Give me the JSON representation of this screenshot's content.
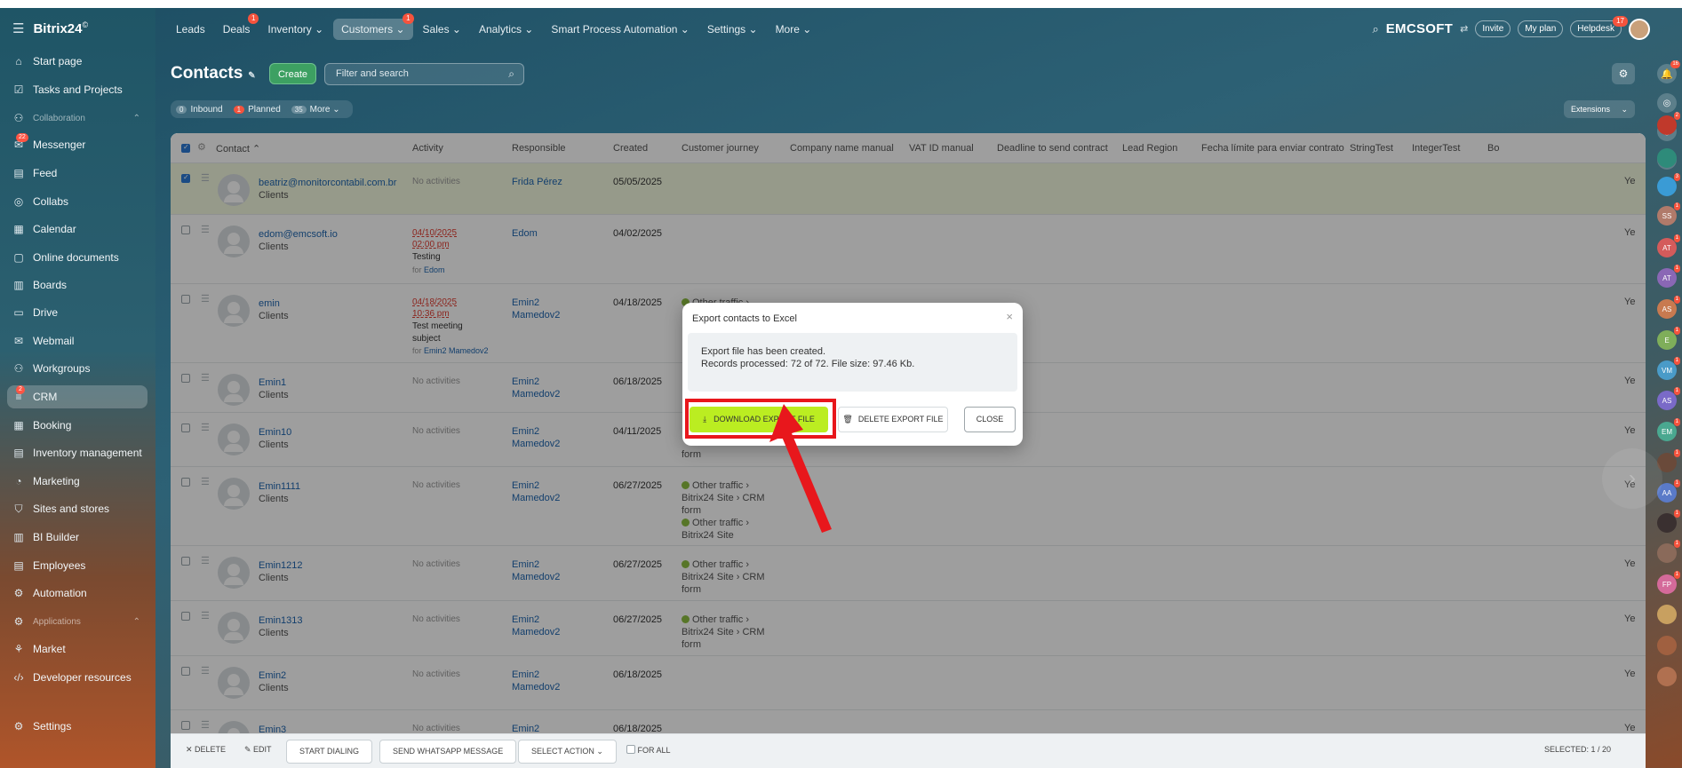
{
  "app": {
    "logo": "Bitrix24",
    "logo_sup": "©",
    "company": "EMCSOFT"
  },
  "topnav": [
    {
      "label": "Leads",
      "badge": ""
    },
    {
      "label": "Deals",
      "badge": "1"
    },
    {
      "label": "Inventory ⌄",
      "badge": ""
    },
    {
      "label": "Customers ⌄",
      "badge": "1",
      "active": true
    },
    {
      "label": "Sales ⌄",
      "badge": ""
    },
    {
      "label": "Analytics ⌄",
      "badge": ""
    },
    {
      "label": "Smart Process Automation ⌄",
      "badge": ""
    },
    {
      "label": "Settings ⌄",
      "badge": ""
    },
    {
      "label": "More ⌄",
      "badge": ""
    }
  ],
  "topright": {
    "invite": "Invite",
    "myplan": "My plan",
    "helpdesk": "Helpdesk",
    "helpdesk_badge": "17"
  },
  "sidebar": [
    {
      "label": "Start page",
      "icon": "⌂"
    },
    {
      "label": "Tasks and Projects",
      "icon": "☑"
    },
    {
      "label": "Collaboration",
      "icon": "⚇",
      "group": true
    },
    {
      "label": "Messenger",
      "icon": "✉",
      "badge": "22"
    },
    {
      "label": "Feed",
      "icon": "▤"
    },
    {
      "label": "Collabs",
      "icon": "◎"
    },
    {
      "label": "Calendar",
      "icon": "▦"
    },
    {
      "label": "Online documents",
      "icon": "▢"
    },
    {
      "label": "Boards",
      "icon": "▥"
    },
    {
      "label": "Drive",
      "icon": "▭"
    },
    {
      "label": "Webmail",
      "icon": "✉"
    },
    {
      "label": "Workgroups",
      "icon": "⚇"
    },
    {
      "label": "CRM",
      "icon": "≡",
      "active": true,
      "badge": "2"
    },
    {
      "label": "Booking",
      "icon": "▦"
    },
    {
      "label": "Inventory management",
      "icon": "▤"
    },
    {
      "label": "Marketing",
      "icon": "◔"
    },
    {
      "label": "Sites and stores",
      "icon": "⛉"
    },
    {
      "label": "BI Builder",
      "icon": "▥"
    },
    {
      "label": "Employees",
      "icon": "▤"
    },
    {
      "label": "Automation",
      "icon": "⚙"
    },
    {
      "label": "Applications",
      "icon": "⚙",
      "group": true
    },
    {
      "label": "Market",
      "icon": "⚘"
    },
    {
      "label": "Developer resources",
      "icon": "‹/›"
    },
    {
      "label": "Settings",
      "icon": "⚙"
    }
  ],
  "page": {
    "title": "Contacts",
    "create": "Create",
    "search_placeholder": "Filter and search",
    "filters": [
      {
        "count": "0",
        "label": "Inbound",
        "red": false
      },
      {
        "count": "1",
        "label": "Planned",
        "red": true
      },
      {
        "count": "35",
        "label": "More ⌄",
        "red": false
      }
    ],
    "extensions": "Extensions"
  },
  "columns": [
    "Contact ⌃",
    "Activity",
    "Responsible",
    "Created",
    "Customer journey",
    "Company name manual",
    "VAT ID manual",
    "Deadline to send contract",
    "Lead Region",
    "Fecha límite para enviar contrato",
    "StringTest",
    "IntegerTest",
    "Bo"
  ],
  "rows": [
    {
      "name": "beatriz@monitorcontabil.com.br",
      "type": "Clients",
      "activity": "No activities",
      "resp": "Frida Pérez",
      "created": "05/05/2025",
      "ye": "Ye",
      "selected": true
    },
    {
      "name": "edom@emcsoft.io",
      "type": "Clients",
      "act_date": "04/10/2025",
      "act_time": "02:00 pm",
      "act_subject": "Testing",
      "act_for": "Edom",
      "resp": "Edom",
      "created": "04/02/2025",
      "ye": "Ye"
    },
    {
      "name": "emin",
      "type": "Clients",
      "act_date": "04/18/2025",
      "act_time": "10:36 pm",
      "act_subject": "Test meeting subject",
      "act_for": "Emin2 Mamedov2",
      "resp": "Emin2 Mamedov2",
      "created": "04/18/2025",
      "journey": "Other traffic ›",
      "ye": "Ye"
    },
    {
      "name": "Emin1",
      "type": "Clients",
      "activity": "No activities",
      "resp": "Emin2 Mamedov2",
      "created": "06/18/2025",
      "ye": "Ye"
    },
    {
      "name": "Emin10",
      "type": "Clients",
      "activity": "No activities",
      "resp": "Emin2 Mamedov2",
      "created": "04/11/2025",
      "journey_tail": "form",
      "ye": "Ye"
    },
    {
      "name": "Emin1111",
      "type": "Clients",
      "activity": "No activities",
      "resp": "Emin2 Mamedov2",
      "created": "06/27/2025",
      "journey": "Other traffic ›",
      "journey2": "Bitrix24 Site › CRM",
      "journey3": "form",
      "journey4": "Other traffic ›",
      "journey5": "Bitrix24 Site",
      "ye": "Ye"
    },
    {
      "name": "Emin1212",
      "type": "Clients",
      "activity": "No activities",
      "resp": "Emin2 Mamedov2",
      "created": "06/27/2025",
      "journey": "Other traffic ›",
      "journey2": "Bitrix24 Site › CRM",
      "journey3": "form",
      "ye": "Ye"
    },
    {
      "name": "Emin1313",
      "type": "Clients",
      "activity": "No activities",
      "resp": "Emin2 Mamedov2",
      "created": "06/27/2025",
      "journey": "Other traffic ›",
      "journey2": "Bitrix24 Site › CRM",
      "journey3": "form",
      "ye": "Ye"
    },
    {
      "name": "Emin2",
      "type": "Clients",
      "activity": "No activities",
      "resp": "Emin2 Mamedov2",
      "created": "06/18/2025",
      "ye": "Ye"
    },
    {
      "name": "Emin3",
      "type": "Clients",
      "activity": "No activities",
      "resp": "Emin2",
      "created": "06/18/2025",
      "ye": "Ye"
    }
  ],
  "bottombar": {
    "delete": "DELETE",
    "edit": "EDIT",
    "dialing": "START DIALING",
    "whatsapp": "SEND WHATSAPP MESSAGE",
    "select_action": "SELECT ACTION",
    "for_all": "FOR ALL",
    "selected": "SELECTED: 1 / 20"
  },
  "modal": {
    "title": "Export contacts to Excel",
    "line1": "Export file has been created.",
    "line2": "Records processed: 72 of 72. File size: 97.46 Kb.",
    "download": "DOWNLOAD EXPORT FILE",
    "delete": "DELETE EXPORT FILE",
    "close": "CLOSE"
  },
  "rail": [
    {
      "label": "",
      "color": "#c0392b",
      "badge": "2"
    },
    {
      "label": "",
      "color": "#2e8b7a",
      "badge": ""
    },
    {
      "label": "",
      "color": "#3a9bd5",
      "badge": "3"
    },
    {
      "label": "SS",
      "color": "#b07a6a",
      "badge": "1"
    },
    {
      "label": "AT",
      "color": "#d45b5b",
      "badge": "1"
    },
    {
      "label": "AT",
      "color": "#8a67b5",
      "badge": "1"
    },
    {
      "label": "AS",
      "color": "#c87a50",
      "badge": "1"
    },
    {
      "label": "E",
      "color": "#7fae5a",
      "badge": "1"
    },
    {
      "label": "VM",
      "color": "#4a9bc8",
      "badge": "1"
    },
    {
      "label": "AS",
      "color": "#7a6ac8",
      "badge": "1"
    },
    {
      "label": "EM",
      "color": "#4aa890",
      "badge": "1"
    },
    {
      "label": "",
      "color": "#6a4a3a",
      "badge": "1"
    },
    {
      "label": "AA",
      "color": "#5a7ac8",
      "badge": "1"
    },
    {
      "label": "",
      "color": "#3a3030",
      "badge": "1"
    },
    {
      "label": "",
      "color": "#8a6a5a",
      "badge": "1"
    },
    {
      "label": "FP",
      "color": "#d46a9a",
      "badge": "1"
    },
    {
      "label": "",
      "color": "#c8a060",
      "badge": ""
    },
    {
      "label": "",
      "color": "#a06040",
      "badge": ""
    },
    {
      "label": "",
      "color": "#b07050",
      "badge": ""
    }
  ]
}
